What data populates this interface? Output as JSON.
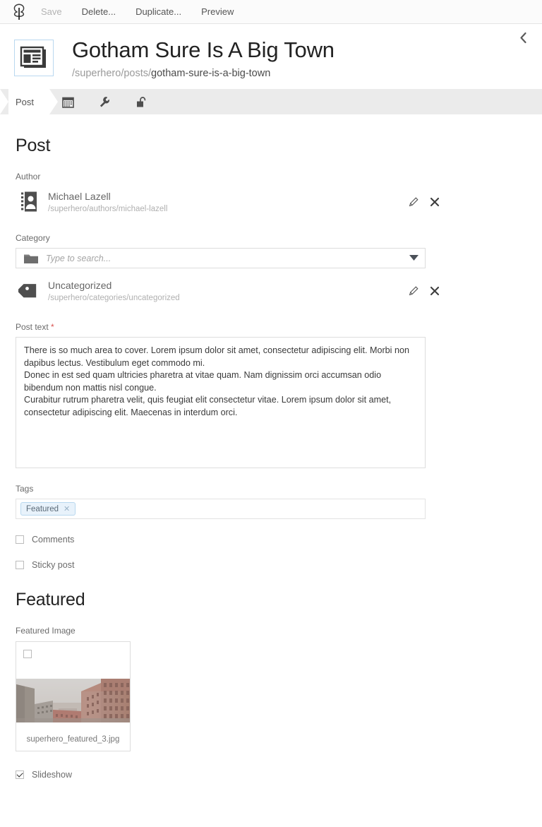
{
  "toolbar": {
    "logo_icon": "grav-tree-logo-icon",
    "items": [
      {
        "label": "Save",
        "name": "save-button",
        "disabled": true
      },
      {
        "label": "Delete...",
        "name": "delete-button",
        "disabled": false
      },
      {
        "label": "Duplicate...",
        "name": "duplicate-button",
        "disabled": false
      },
      {
        "label": "Preview",
        "name": "preview-button",
        "disabled": false
      }
    ]
  },
  "header": {
    "page_icon": "newspaper-page-icon",
    "title": "Gotham Sure Is A Big Town",
    "breadcrumb_prefix": "/superhero/posts/",
    "breadcrumb_leaf": "gotham-sure-is-a-big-town",
    "collapse_icon": "chevron-left-icon"
  },
  "tabs": [
    {
      "label": "Post",
      "icon": "",
      "active": true,
      "name": "tab-post"
    },
    {
      "label": "",
      "icon": "calendar-icon",
      "active": false,
      "name": "tab-options"
    },
    {
      "label": "",
      "icon": "wrench-icon",
      "active": false,
      "name": "tab-advanced"
    },
    {
      "label": "",
      "icon": "unlock-icon",
      "active": false,
      "name": "tab-security"
    }
  ],
  "post_section": {
    "heading": "Post",
    "author": {
      "label": "Author",
      "icon": "contact-card-icon",
      "name": "Michael Lazell",
      "path": "/superhero/authors/michael-lazell",
      "edit_icon": "pencil-edit-icon",
      "remove_icon": "close-x-icon"
    },
    "category": {
      "label": "Category",
      "folder_icon": "folder-icon",
      "placeholder": "Type to search...",
      "caret_icon": "caret-down-icon",
      "selected": {
        "icon": "tag-icon",
        "name": "Uncategorized",
        "path": "/superhero/categories/uncategorized",
        "edit_icon": "pencil-edit-icon",
        "remove_icon": "close-x-icon"
      }
    },
    "post_text": {
      "label": "Post text",
      "required_marker": "*",
      "value": "There is so much area to cover. Lorem ipsum dolor sit amet, consectetur adipiscing elit. Morbi non dapibus lectus. Vestibulum eget commodo mi.\nDonec in est sed quam ultricies pharetra at vitae quam. Nam dignissim orci accumsan odio bibendum non mattis nisl congue.\nCurabitur rutrum pharetra velit, quis feugiat elit consectetur vitae. Lorem ipsum dolor sit amet, consectetur adipiscing elit. Maecenas in interdum orci."
    },
    "tags": {
      "label": "Tags",
      "chips": [
        {
          "label": "Featured",
          "remove_icon": "close-x-icon"
        }
      ]
    },
    "comments": {
      "label": "Comments",
      "checked": false
    },
    "sticky_post": {
      "label": "Sticky post",
      "checked": false
    }
  },
  "featured_section": {
    "heading": "Featured",
    "featured_image": {
      "label": "Featured Image",
      "filename": "superhero_featured_3.jpg",
      "selected": false,
      "alt_description": "foggy city street lined with brick apartment buildings"
    },
    "slideshow": {
      "label": "Slideshow",
      "checked": true
    }
  },
  "colors": {
    "toolbar_bg": "#fbfbfb",
    "tabbar_bg": "#ebebeb",
    "accent_border": "#b9d8f0",
    "chip_bg": "#e8f2fb",
    "chip_border": "#b8d8ef",
    "required": "#d9534f",
    "muted_text": "#b0b0b0"
  }
}
